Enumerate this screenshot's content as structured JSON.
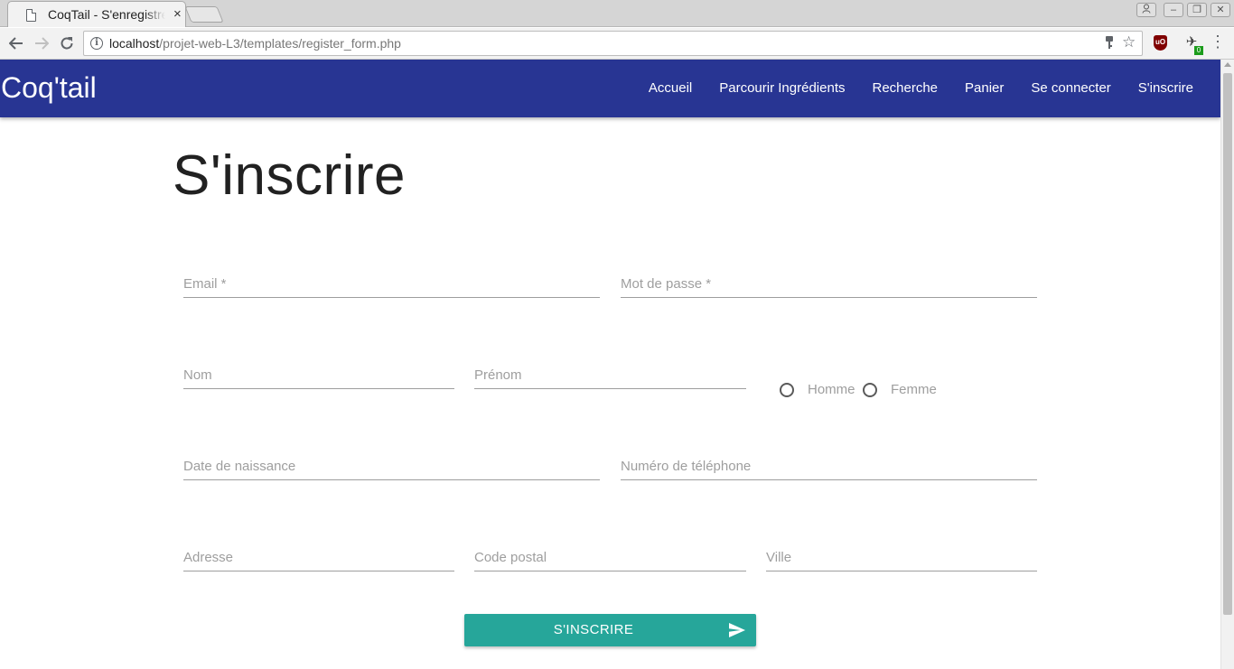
{
  "browser": {
    "tab_title": "CoqTail - S'enregistrer",
    "tab_close": "×",
    "url_host": "localhost",
    "url_path": "/projet-web-L3/templates/register_form.php",
    "extension_badge": "0"
  },
  "navbar": {
    "brand": "Coq'tail",
    "links": [
      "Accueil",
      "Parcourir Ingrédients",
      "Recherche",
      "Panier",
      "Se connecter",
      "S'inscrire"
    ]
  },
  "page": {
    "title": "S'inscrire"
  },
  "form": {
    "email_placeholder": "Email *",
    "password_placeholder": "Mot de passe *",
    "nom_placeholder": "Nom",
    "prenom_placeholder": "Prénom",
    "gender_options": [
      "Homme",
      "Femme"
    ],
    "birthdate_placeholder": "Date de naissance",
    "phone_placeholder": "Numéro de téléphone",
    "address_placeholder": "Adresse",
    "postal_placeholder": "Code postal",
    "city_placeholder": "Ville",
    "submit_label": "S'INSCRIRE"
  },
  "colors": {
    "navbar": "#283593",
    "button": "#26a69a"
  },
  "icons": {
    "back": "arrow-left-icon",
    "forward": "arrow-right-icon",
    "reload": "reload-icon",
    "submit": "send-icon"
  }
}
